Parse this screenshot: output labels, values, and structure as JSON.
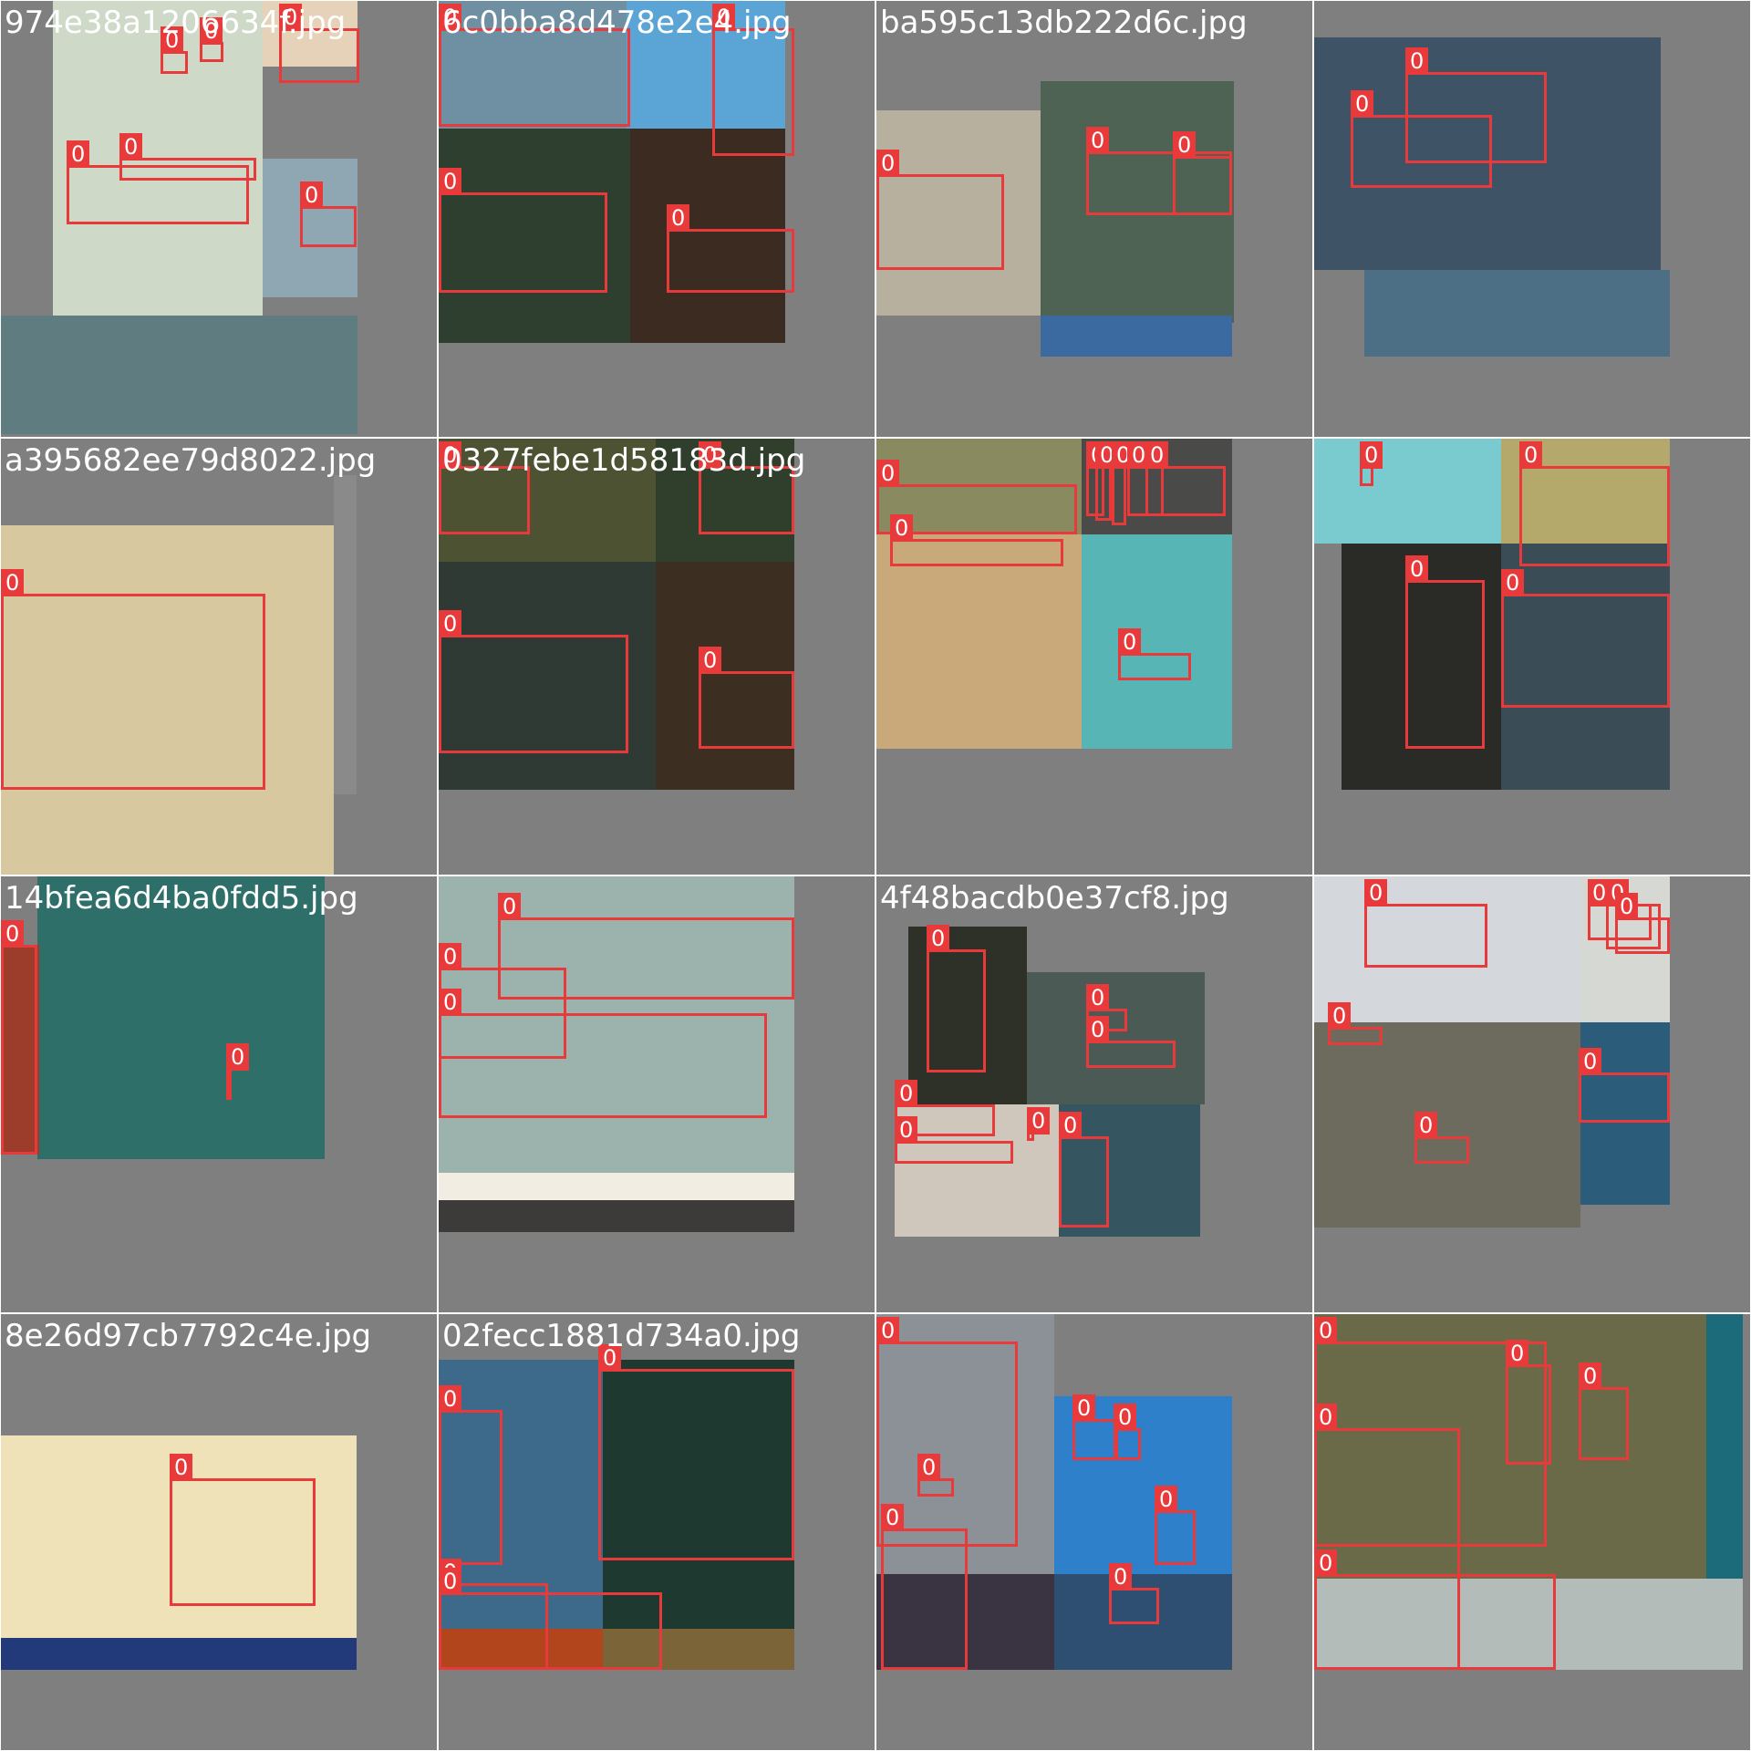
{
  "grid": {
    "columns": 4,
    "rows": 4,
    "box_color": "#e83a3a",
    "background_color": "#7f7f7f",
    "tiles": [
      {
        "name": "974e38a1206634f.jpg",
        "photos": [
          {
            "c": "#cfd9c8"
          },
          {
            "c": "#e6d2b8"
          },
          {
            "c": "#8fa7b3"
          },
          {
            "c": "#5f7d80"
          }
        ],
        "boxes": [
          {
            "l": "0"
          },
          {
            "l": "0"
          },
          {
            "l": "0"
          },
          {
            "l": "0"
          },
          {
            "l": "0"
          },
          {
            "l": "0"
          }
        ]
      },
      {
        "name": "6c0bba8d478e2e4.jpg",
        "photos": [
          {
            "c": "#6f90a3"
          },
          {
            "c": "#5aa5d6"
          },
          {
            "c": "#2e3f2f"
          },
          {
            "c": "#3b2b20"
          }
        ],
        "boxes": [
          {
            "l": "0"
          },
          {
            "l": "0"
          },
          {
            "l": "0"
          },
          {
            "l": "0"
          }
        ]
      },
      {
        "name": "ba595c13db222d6c.jpg",
        "photos": [
          {
            "c": "#b7b09f"
          },
          {
            "c": "#4e6353"
          },
          {
            "c": "#3a6aa0"
          }
        ],
        "boxes": [
          {
            "l": "0"
          },
          {
            "l": "0"
          },
          {
            "l": "0"
          }
        ]
      },
      {
        "name": "",
        "photos": [
          {
            "c": "#3e5365"
          },
          {
            "c": "#4d6f86"
          }
        ],
        "boxes": [
          {
            "l": "0"
          },
          {
            "l": "0"
          }
        ]
      },
      {
        "name": "a395682ee79d8022.jpg",
        "photos": [
          {
            "c": "#d8c8a0"
          },
          {
            "c": "#8a8a8a"
          }
        ],
        "boxes": [
          {
            "l": "0"
          }
        ]
      },
      {
        "name": "0327febe1d58183d.jpg",
        "photos": [
          {
            "c": "#4d5232"
          },
          {
            "c": "#2f3f2c"
          },
          {
            "c": "#2f3a35"
          },
          {
            "c": "#3d2e22"
          }
        ],
        "boxes": [
          {
            "l": "0"
          },
          {
            "l": "0"
          },
          {
            "l": "0"
          },
          {
            "l": "0"
          }
        ]
      },
      {
        "name": "",
        "photos": [
          {
            "c": "#8a8a60"
          },
          {
            "c": "#4a4a48"
          },
          {
            "c": "#c9a87a"
          },
          {
            "c": "#58b5b6"
          }
        ],
        "boxes": [
          {
            "l": "0"
          },
          {
            "l": "0"
          },
          {
            "l": "0"
          },
          {
            "l": "0"
          },
          {
            "l": "0"
          },
          {
            "l": "0"
          },
          {
            "l": "0"
          },
          {
            "l": "0"
          }
        ]
      },
      {
        "name": "",
        "photos": [
          {
            "c": "#79cbd0"
          },
          {
            "c": "#b4a86a"
          },
          {
            "c": "#2a2a26"
          },
          {
            "c": "#3a4c56"
          }
        ],
        "boxes": [
          {
            "l": "0"
          },
          {
            "l": "0"
          },
          {
            "l": "0"
          },
          {
            "l": "0"
          }
        ]
      },
      {
        "name": "14bfea6d4ba0fdd5.jpg",
        "photos": [
          {
            "c": "#2e6f6a"
          },
          {
            "c": "#9b3d2a"
          }
        ],
        "boxes": [
          {
            "l": "0"
          },
          {
            "l": "0"
          },
          {
            "l": "0"
          }
        ]
      },
      {
        "name": "",
        "photos": [
          {
            "c": "#9cb3ad"
          },
          {
            "c": "#f1ede2"
          },
          {
            "c": "#3d3b3a"
          }
        ],
        "boxes": [
          {
            "l": "0"
          },
          {
            "l": "0"
          },
          {
            "l": "0"
          }
        ]
      },
      {
        "name": "4f48bacdb0e37cf8.jpg",
        "photos": [
          {
            "c": "#2d3128"
          },
          {
            "c": "#4b5a55"
          },
          {
            "c": "#cfc6bc"
          },
          {
            "c": "#355560"
          }
        ],
        "boxes": [
          {
            "l": "0"
          },
          {
            "l": "0"
          },
          {
            "l": "0"
          },
          {
            "l": "0"
          },
          {
            "l": "0"
          },
          {
            "l": "0"
          },
          {
            "l": "0"
          }
        ]
      },
      {
        "name": "",
        "photos": [
          {
            "c": "#d4d7dc"
          },
          {
            "c": "#d6d8d4"
          },
          {
            "c": "#6c6b5e"
          },
          {
            "c": "#2b5d7a"
          }
        ],
        "boxes": [
          {
            "l": "0"
          },
          {
            "l": "0"
          },
          {
            "l": "0"
          },
          {
            "l": "0"
          },
          {
            "l": "0"
          },
          {
            "l": "0"
          },
          {
            "l": "0"
          }
        ]
      },
      {
        "name": "8e26d97cb7792c4e.jpg",
        "photos": [
          {
            "c": "#f0e2b8"
          },
          {
            "c": "#233a7a"
          }
        ],
        "boxes": [
          {
            "l": "0"
          }
        ]
      },
      {
        "name": "02fecc1881d734a0.jpg",
        "photos": [
          {
            "c": "#3d6a8a"
          },
          {
            "c": "#1e3a30"
          },
          {
            "c": "#b2451c"
          },
          {
            "c": "#7a6438"
          }
        ],
        "boxes": [
          {
            "l": "0"
          },
          {
            "l": "0"
          },
          {
            "l": "0"
          },
          {
            "l": "0"
          }
        ]
      },
      {
        "name": "",
        "photos": [
          {
            "c": "#8c9097"
          },
          {
            "c": "#2d80c9"
          },
          {
            "c": "#3a3442"
          },
          {
            "c": "#2f4f72"
          }
        ],
        "boxes": [
          {
            "l": "0"
          },
          {
            "l": "0"
          },
          {
            "l": "0"
          },
          {
            "l": "0"
          },
          {
            "l": "0"
          },
          {
            "l": "0"
          },
          {
            "l": "0"
          }
        ]
      },
      {
        "name": "",
        "photos": [
          {
            "c": "#6b6a48"
          },
          {
            "c": "#1b6b7a"
          },
          {
            "c": "#b3bcb9"
          }
        ],
        "boxes": [
          {
            "l": "0"
          },
          {
            "l": "0"
          },
          {
            "l": "0"
          },
          {
            "l": "0"
          },
          {
            "l": "0"
          }
        ]
      }
    ]
  }
}
